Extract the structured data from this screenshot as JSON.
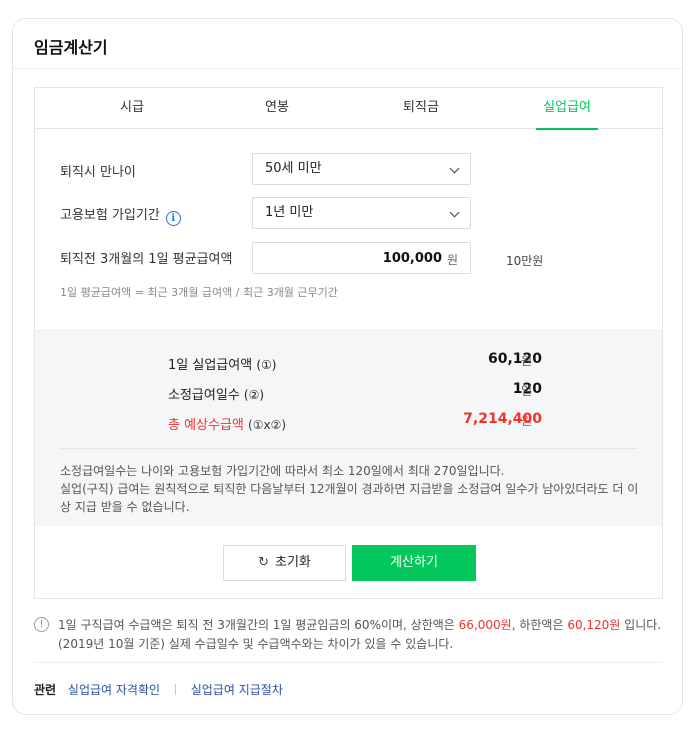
{
  "title": "임금계산기",
  "tabs": [
    {
      "label": "시급"
    },
    {
      "label": "연봉"
    },
    {
      "label": "퇴직금"
    },
    {
      "label": "실업급여",
      "active": true
    }
  ],
  "form": {
    "age_label": "퇴직시 만나이",
    "age_value": "50세 미만",
    "insurance_label": "고용보험 가입기간",
    "insurance_value": "1년 미만",
    "avg_wage_label": "퇴직전 3개월의 1일 평균급여액",
    "avg_wage_value": "100,000",
    "avg_wage_unit": "원",
    "avg_wage_hint": "10만원",
    "formula": "1일 평균급여액 = 최근 3개월 급여액 / 최근 3개월 근무기간"
  },
  "results": {
    "daily_label": "1일 실업급여액",
    "daily_mark": "(①)",
    "daily_value": "60,120",
    "daily_unit": "원",
    "days_label": "소정급여일수",
    "days_mark": "(②)",
    "days_value": "120",
    "days_unit": "일",
    "total_label": "총 예상수급액",
    "total_mark": "(①x②)",
    "total_value": "7,214,400",
    "total_unit": "원",
    "note_line1": "소정급여일수는 나이와 고용보험 가입기간에 따라서 최소 120일에서 최대 270일입니다.",
    "note_line2": "실업(구직) 급여는 원칙적으로 퇴직한 다음날부터 12개월이 경과하면 지급받을 소정급여 일수가 남아있더라도 더 이상 지급 받을 수 없습니다."
  },
  "buttons": {
    "reset": "초기화",
    "calculate": "계산하기"
  },
  "footer": {
    "part1": "1일 구직급여 수급액은 퇴직 전 3개월간의 1일 평균임금의 60%이며, 상한액은 ",
    "upper": "66,000원",
    "part2": ", 하한액은 ",
    "lower": "60,120원",
    "part3": " 입니다. (2019년 10월 기준) 실제 수급일수 및 수급액수와는 차이가 있을 수 있습니다."
  },
  "related": {
    "label": "관련",
    "links": [
      "실업급여 자격확인",
      "실업급여 지급절차"
    ]
  },
  "colors": {
    "accent": "#03c75a",
    "highlight": "#f0322d",
    "link": "#2b4fa5"
  }
}
